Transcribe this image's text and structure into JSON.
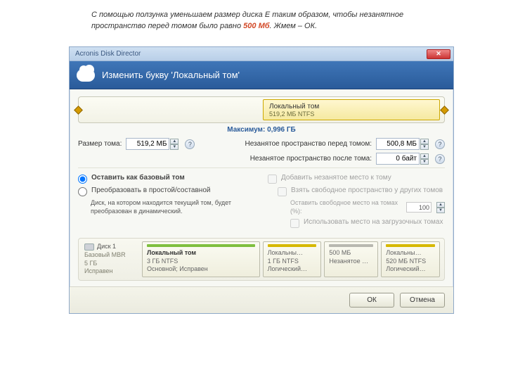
{
  "caption": {
    "pre": "С помощью ползунка уменьшаем размер диска Е таким образом, чтобы незанятное пространство перед томом было равно ",
    "hl": "500 Мб",
    "post": ". Жмем – ОК."
  },
  "window": {
    "app_title": "Acronis Disk Director",
    "header": "Изменить букву 'Локальный том'"
  },
  "volbox": {
    "name": "Локальный том",
    "sub": "519,2 МБ NTFS"
  },
  "maxline": "Максимум: 0,996 ГБ",
  "fields": {
    "size_label": "Размер тома:",
    "size_value": "519,2 МБ",
    "before_label": "Незанятое пространство перед томом:",
    "before_value": "500,8 МБ",
    "after_label": "Незанятое пространство после тома:",
    "after_value": "0 байт"
  },
  "left": {
    "opt1": "Оставить как базовый том",
    "opt2": "Преобразовать в простой/составной",
    "note": "Диск, на котором находится текущий том, будет преобразован в динамический."
  },
  "right": {
    "chk1": "Добавить незанятое место к тому",
    "chk2": "Взять свободное пространство у других томов",
    "lbl3": "Оставить свободное место на томах (%):",
    "val3": "100",
    "chk4": "Использовать место на загрузочных томах"
  },
  "disk": {
    "title": "Диск 1",
    "l1": "Базовый MBR",
    "l2": "5 ГБ",
    "l3": "Исправен"
  },
  "parts": [
    {
      "cls": "green",
      "name": "Локальный том",
      "l1": "3 ГБ NTFS",
      "l2": "Основной; Исправен"
    },
    {
      "cls": "yellow",
      "name": "Локальны…",
      "l1": "1 ГБ NTFS",
      "l2": "Логический…"
    },
    {
      "cls": "gray",
      "name": "",
      "l1": "500 МБ",
      "l2": "Незанятое …"
    },
    {
      "cls": "yellow",
      "name": "Локальны…",
      "l1": "520 МБ NTFS",
      "l2": "Логический…"
    }
  ],
  "buttons": {
    "ok": "ОК",
    "cancel": "Отмена"
  }
}
